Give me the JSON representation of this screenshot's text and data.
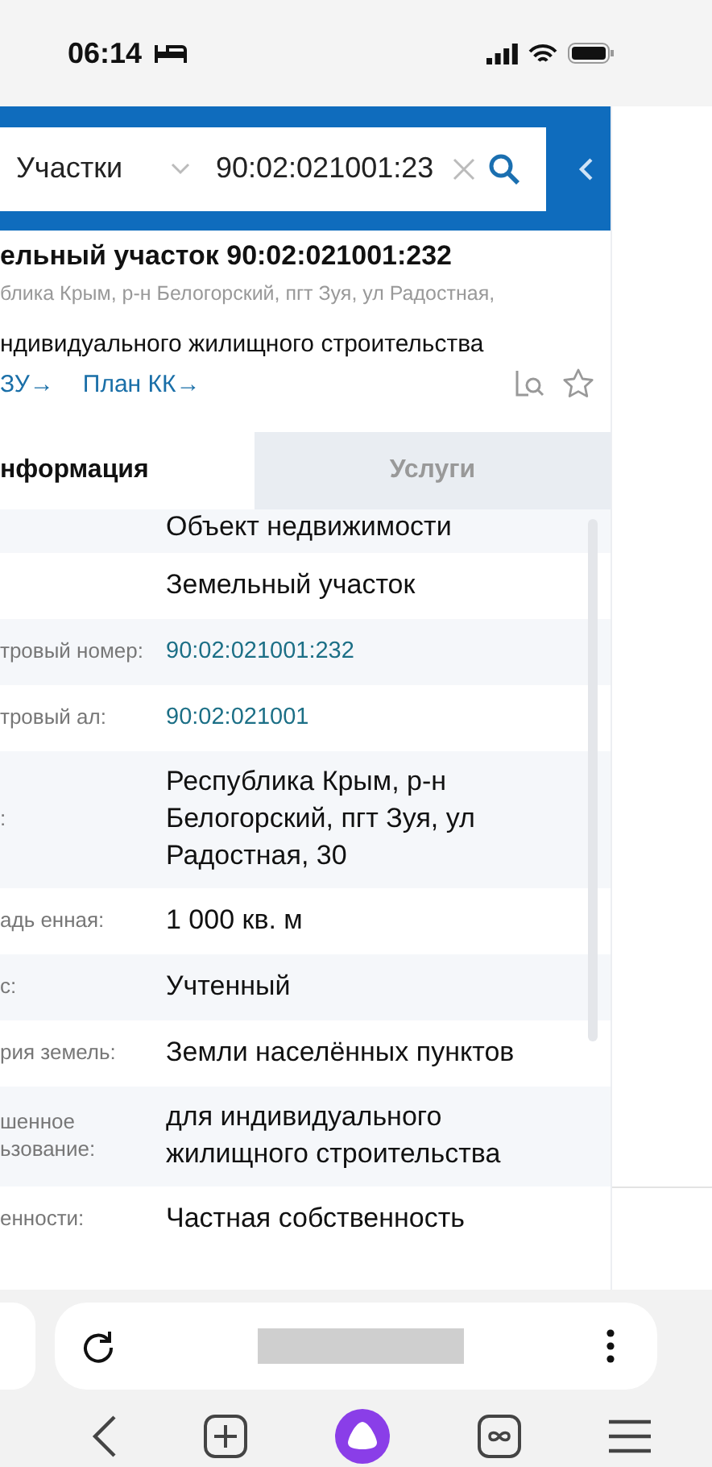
{
  "status_bar": {
    "time": "06:14"
  },
  "search": {
    "category": "Участки",
    "query": "90:02:021001:23"
  },
  "card": {
    "title": "ельный участок 90:02:021001:232",
    "address": "блика Крым, р-н Белогорский, пгт Зуя, ул Радостная,",
    "purpose": "ндивидуального жилищного строительства",
    "links": [
      "ЗУ→",
      "План КК→"
    ]
  },
  "tabs": [
    {
      "label": "нформация",
      "selected": true
    },
    {
      "label": "Услуги",
      "selected": false
    }
  ],
  "rows": [
    {
      "value": "Объект недвижимости",
      "kind": "text"
    },
    {
      "value": "Земельный участок",
      "kind": "text"
    },
    {
      "label": "тровый номер:",
      "value": "90:02:021001:232",
      "kind": "link"
    },
    {
      "label": "тровый ал:",
      "value": "90:02:021001",
      "kind": "link"
    },
    {
      "label": ":",
      "value": "Республика Крым, р-н Белогорский, пгт Зуя, ул Радостная, 30",
      "kind": "text"
    },
    {
      "label": "адь енная:",
      "value": "1 000 кв. м",
      "kind": "text"
    },
    {
      "label": "с:",
      "value": "Учтенный",
      "kind": "text"
    },
    {
      "label": "рия земель:",
      "value": "Земли населённых пунктов",
      "kind": "text"
    },
    {
      "label": "шенное ьзование:",
      "value": "для индивидуального жилищного строительства",
      "kind": "text"
    },
    {
      "label": "енности:",
      "value": "Частная собственность",
      "kind": "text"
    }
  ]
}
